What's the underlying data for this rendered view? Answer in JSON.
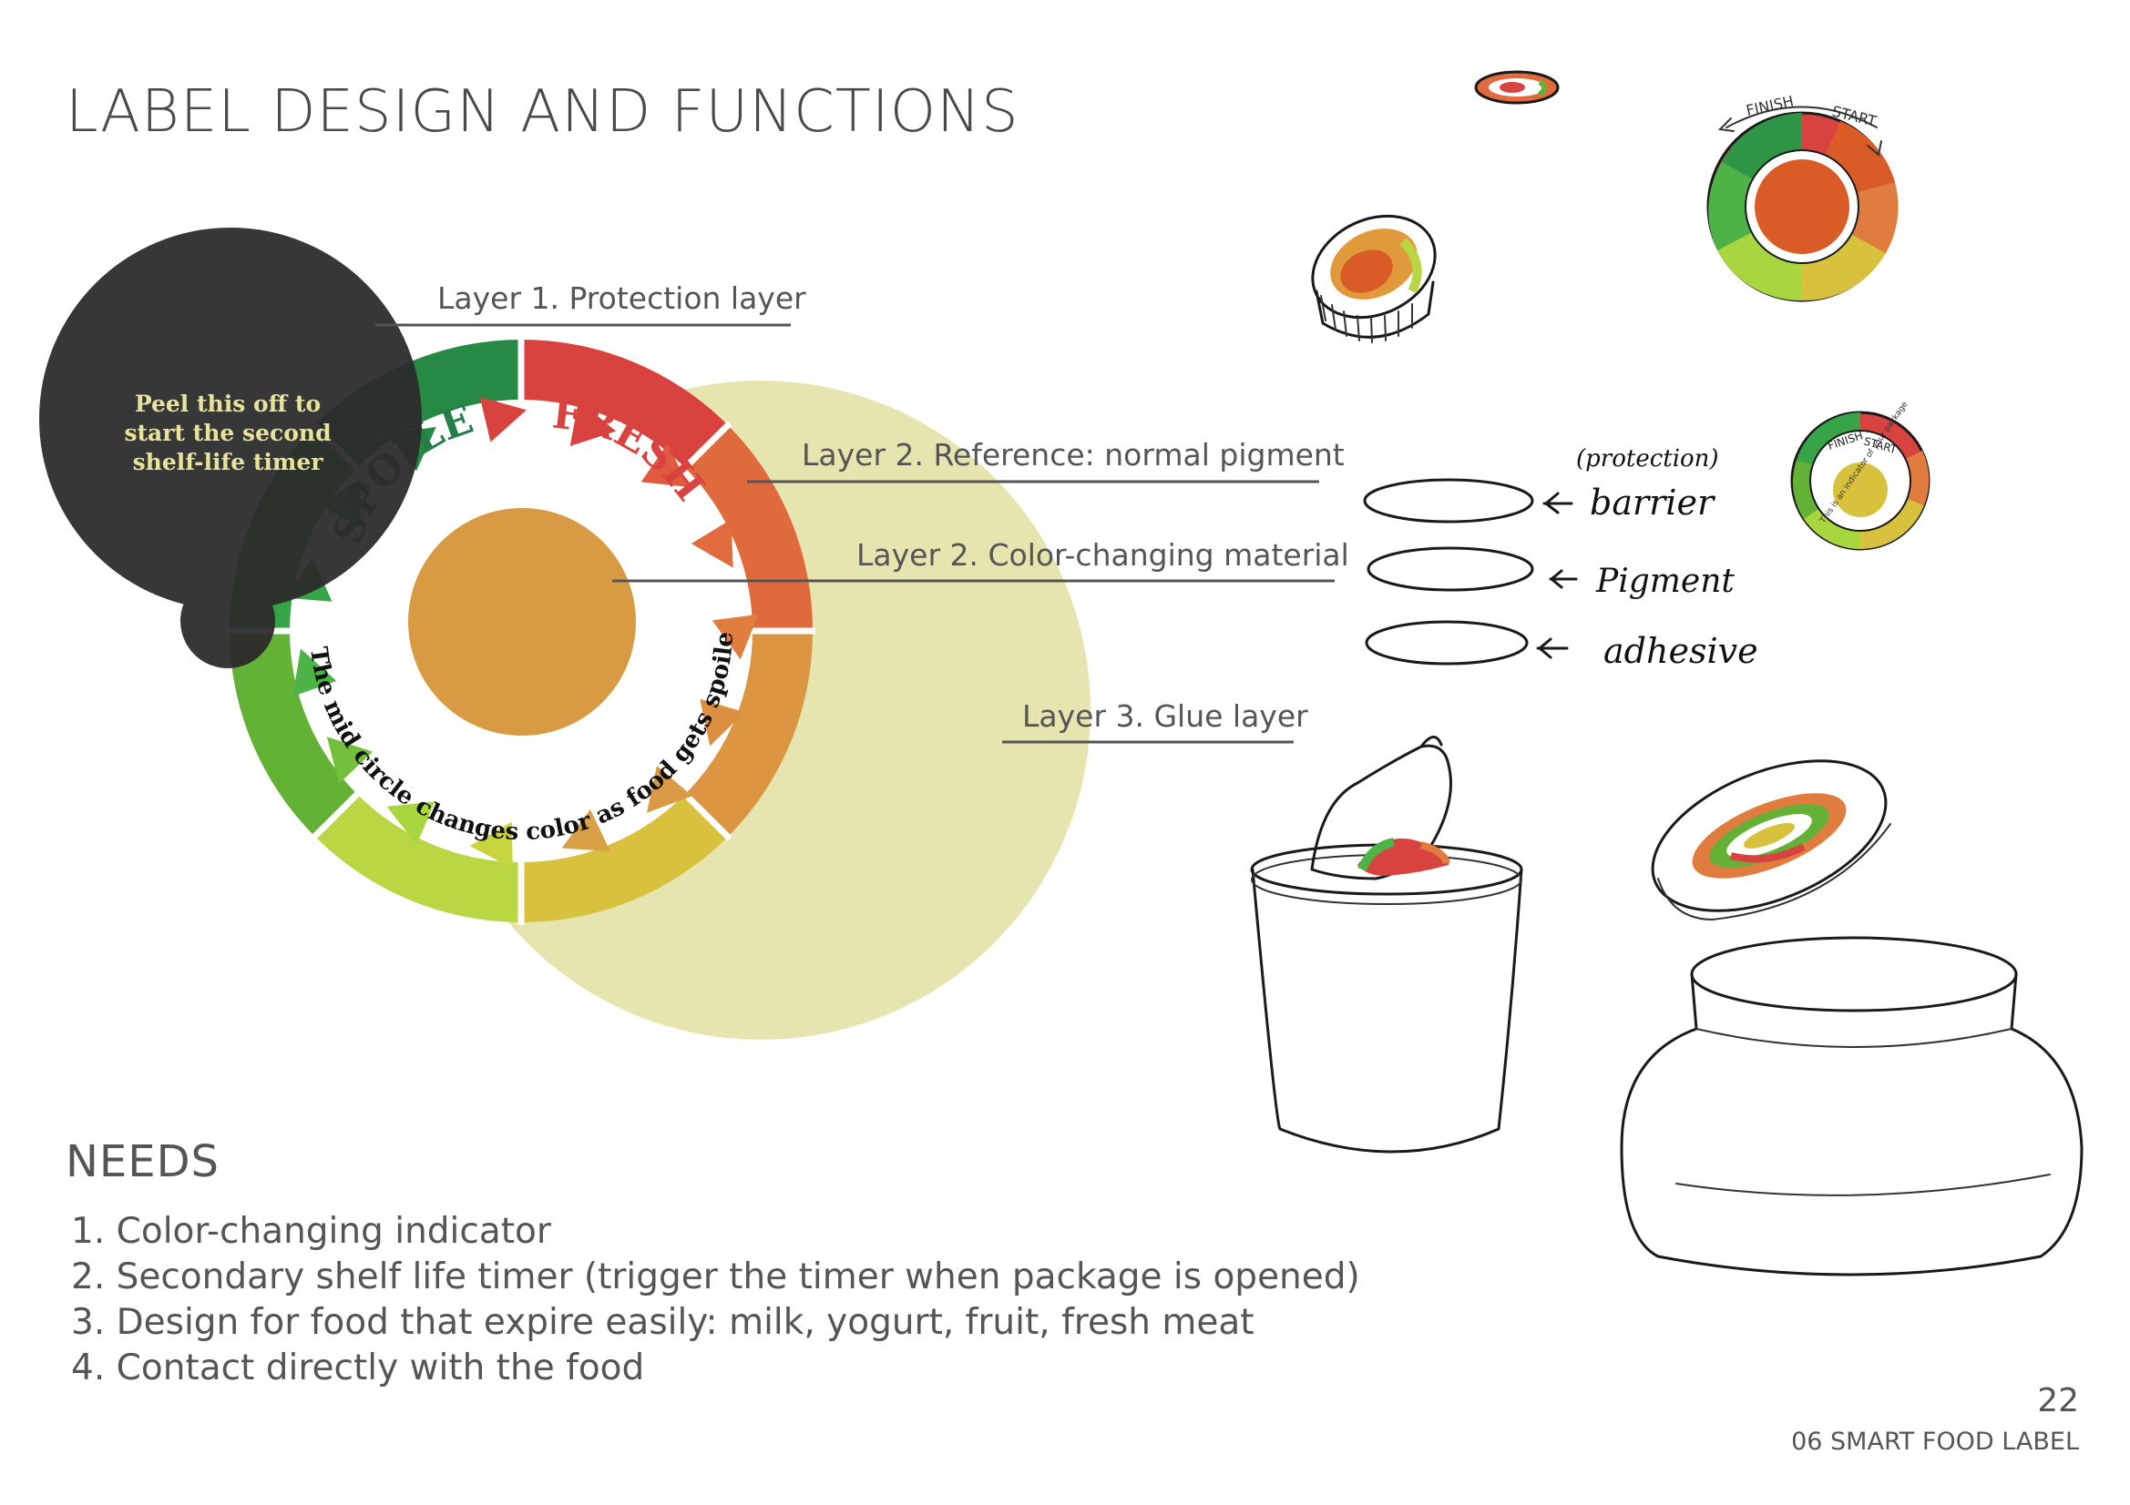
{
  "title": "LABEL DESIGN AND FUNCTIONS",
  "layers": [
    {
      "label": "Layer 1. Protection layer"
    },
    {
      "label": "Layer 2. Reference: normal pigment"
    },
    {
      "label": "Layer 2. Color-changing material"
    },
    {
      "label": "Layer 3. Glue layer"
    }
  ],
  "peel_note": {
    "line1": "Peel this off to",
    "line2": "start the second",
    "line3": "shelf-life timer"
  },
  "dial": {
    "fresh_text": "FRESH",
    "spoiled_text": "SPOILED",
    "arc_text": "The mid circle changes color as food gets spoiled"
  },
  "sketch_labels": {
    "protection": "(protection)",
    "barrier": "barrier",
    "pigment": "Pigment",
    "adhesive": "adhesive",
    "finish": "FINISH",
    "start": "START",
    "indicator_note": "This is an indicator of your package"
  },
  "needs": {
    "title": "NEEDS",
    "items": [
      "1. Color-changing indicator",
      "2. Secondary shelf life timer (trigger the timer when package is opened)",
      "3. Design for food that expire easily: milk, yogurt, fruit, fresh meat",
      "4. Contact directly with the food"
    ]
  },
  "page_number": "22",
  "footer": "06 SMART FOOD LABEL",
  "colors": {
    "peel_layer": "#2b2b2b",
    "peel_text": "#e8e39a",
    "glue_layer": "#e6e5b0",
    "center_pigment": "#d89a42",
    "fresh_red": "#d9433f",
    "spoiled_green": "#237f47"
  }
}
